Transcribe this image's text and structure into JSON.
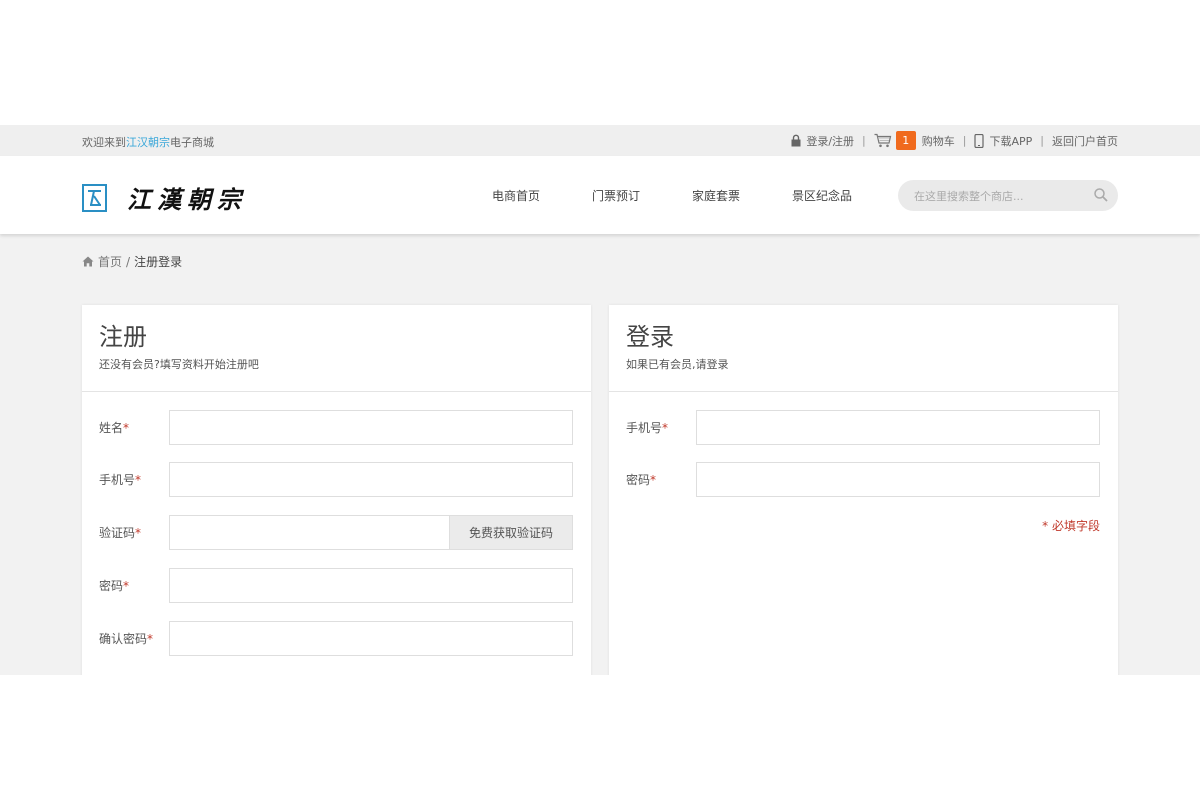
{
  "topbar": {
    "welcome_prefix": "欢迎来到",
    "welcome_brand": "江汉朝宗",
    "welcome_suffix": "电子商城",
    "login_register": "登录/注册",
    "cart_count": "1",
    "cart_label": "购物车",
    "download_app": "下载APP",
    "back_portal": "返回门户首页"
  },
  "header": {
    "logo_text": "江漢朝宗",
    "nav": [
      "电商首页",
      "门票预订",
      "家庭套票",
      "景区纪念品"
    ],
    "search_placeholder": "在这里搜索整个商店..."
  },
  "breadcrumb": {
    "home": "首页",
    "separator": "/",
    "current": "注册登录"
  },
  "register": {
    "title": "注册",
    "subtitle": "还没有会员?填写资料开始注册吧",
    "fields": {
      "name": "姓名",
      "phone": "手机号",
      "code": "验证码",
      "password": "密码",
      "confirm": "确认密码"
    },
    "required_mark": "*",
    "code_button": "免费获取验证码"
  },
  "login": {
    "title": "登录",
    "subtitle": "如果已有会员,请登录",
    "fields": {
      "phone": "手机号",
      "password": "密码"
    },
    "required_mark": "*",
    "required_note": "* 必填字段"
  },
  "colors": {
    "accent_orange": "#f06a1d",
    "brand_blue": "#3aa7d9",
    "required_red": "#c0392b"
  }
}
